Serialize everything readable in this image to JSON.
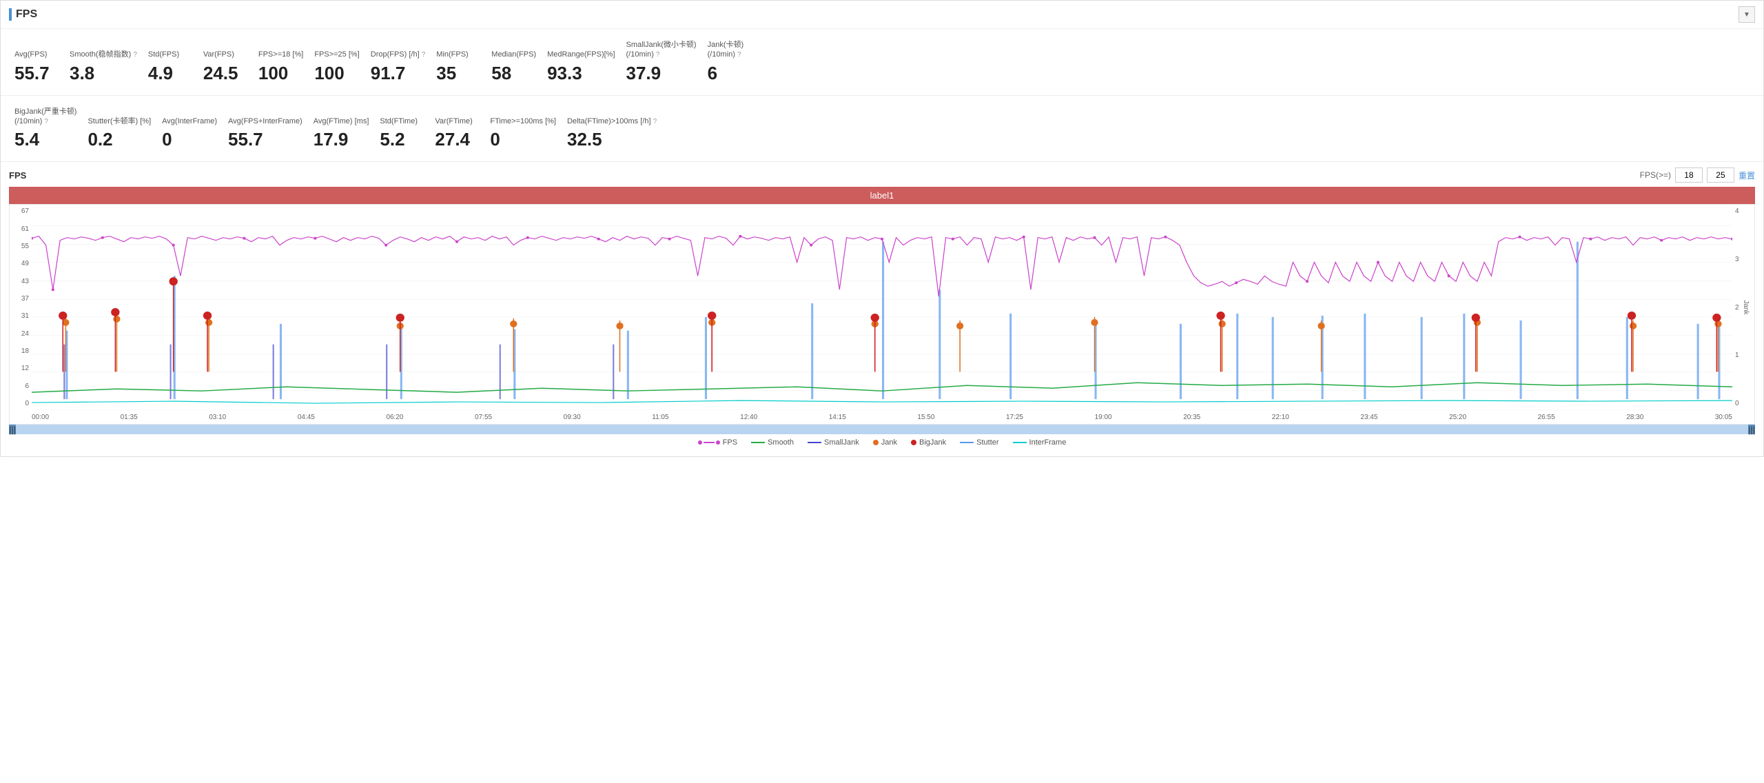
{
  "panel": {
    "title": "FPS",
    "collapse_label": "▼"
  },
  "metrics_row1": [
    {
      "id": "avg-fps",
      "label": "Avg(FPS)",
      "value": "55.7",
      "help": false
    },
    {
      "id": "smooth",
      "label": "Smooth(稳帧指数)",
      "value": "3.8",
      "help": true
    },
    {
      "id": "std-fps",
      "label": "Std(FPS)",
      "value": "4.9",
      "help": false
    },
    {
      "id": "var-fps",
      "label": "Var(FPS)",
      "value": "24.5",
      "help": false
    },
    {
      "id": "fps18",
      "label": "FPS>=18 [%]",
      "value": "100",
      "help": false
    },
    {
      "id": "fps25",
      "label": "FPS>=25 [%]",
      "value": "100",
      "help": false
    },
    {
      "id": "drop-fps",
      "label": "Drop(FPS) [/h]",
      "value": "91.7",
      "help": true
    },
    {
      "id": "min-fps",
      "label": "Min(FPS)",
      "value": "35",
      "help": false
    },
    {
      "id": "median-fps",
      "label": "Median(FPS)",
      "value": "58",
      "help": false
    },
    {
      "id": "medrange-fps",
      "label": "MedRange(FPS)[%]",
      "value": "93.3",
      "help": false
    },
    {
      "id": "smalljank",
      "label": "SmallJank(微小卡顿)\n(/10min)",
      "value": "37.9",
      "help": true
    },
    {
      "id": "jank",
      "label": "Jank(卡顿)\n(/10min)",
      "value": "6",
      "help": true
    }
  ],
  "metrics_row2": [
    {
      "id": "bigjank",
      "label": "BigJank(严重卡顿)\n(/10min)",
      "value": "5.4",
      "help": true
    },
    {
      "id": "stutter",
      "label": "Stutter(卡顿率) [%]",
      "value": "0.2",
      "help": false
    },
    {
      "id": "avg-interframe",
      "label": "Avg(InterFrame)",
      "value": "0",
      "help": false
    },
    {
      "id": "avg-fps-interframe",
      "label": "Avg(FPS+InterFrame)",
      "value": "55.7",
      "help": false
    },
    {
      "id": "avg-ftime",
      "label": "Avg(FTime) [ms]",
      "value": "17.9",
      "help": false
    },
    {
      "id": "std-ftime",
      "label": "Std(FTime)",
      "value": "5.2",
      "help": false
    },
    {
      "id": "var-ftime",
      "label": "Var(FTime)",
      "value": "27.4",
      "help": false
    },
    {
      "id": "ftime100",
      "label": "FTime>=100ms [%]",
      "value": "0",
      "help": false
    },
    {
      "id": "delta-ftime",
      "label": "Delta(FTime)>100ms [/h]",
      "value": "32.5",
      "help": true
    }
  ],
  "chart": {
    "title": "FPS",
    "filter_label": "FPS(>=)",
    "input1": "18",
    "input2": "25",
    "reset_label": "重置",
    "label_bar": "label1",
    "y_left_ticks": [
      "67",
      "61",
      "55",
      "49",
      "43",
      "37",
      "31",
      "24",
      "18",
      "12",
      "6",
      "0"
    ],
    "y_right_ticks": [
      "4",
      "3",
      "2",
      "1",
      "0"
    ],
    "x_ticks": [
      "00:00",
      "01:35",
      "03:10",
      "04:45",
      "06:20",
      "07:55",
      "09:30",
      "11:05",
      "12:40",
      "14:15",
      "15:50",
      "17:25",
      "19:00",
      "20:35",
      "22:10",
      "23:45",
      "25:20",
      "26:55",
      "28:30",
      "30:05"
    ]
  },
  "legend": [
    {
      "id": "fps-legend",
      "label": "FPS",
      "color": "#cc44cc",
      "type": "dot-line"
    },
    {
      "id": "smooth-legend",
      "label": "Smooth",
      "color": "#22aa44",
      "type": "line"
    },
    {
      "id": "smalljank-legend",
      "label": "SmallJank",
      "color": "#4444cc",
      "type": "line"
    },
    {
      "id": "jank-legend",
      "label": "Jank",
      "color": "#e07020",
      "type": "dot"
    },
    {
      "id": "bigjank-legend",
      "label": "BigJank",
      "color": "#cc2222",
      "type": "dot"
    },
    {
      "id": "stutter-legend",
      "label": "Stutter",
      "color": "#5599ee",
      "type": "line"
    },
    {
      "id": "interframe-legend",
      "label": "InterFrame",
      "color": "#00cccc",
      "type": "line"
    }
  ]
}
